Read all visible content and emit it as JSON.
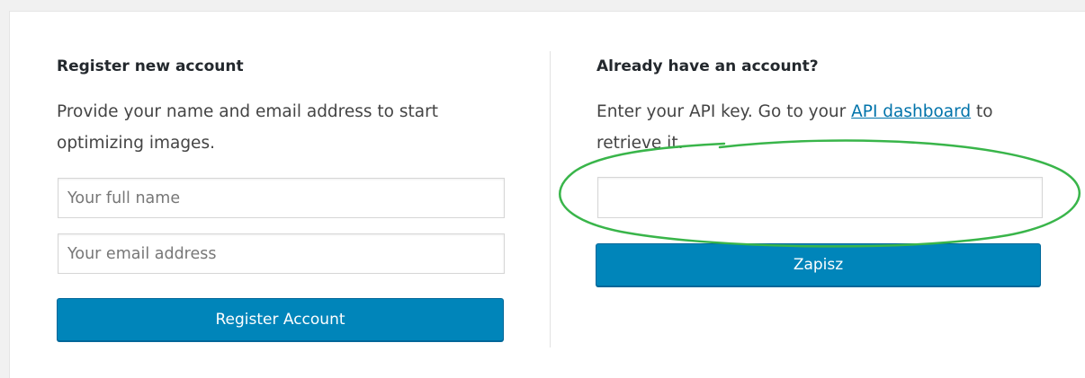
{
  "register": {
    "heading": "Register new account",
    "description": "Provide your name and email address to start optimizing images.",
    "name_placeholder": "Your full name",
    "email_placeholder": "Your email address",
    "button_label": "Register Account"
  },
  "existing": {
    "heading": "Already have an account?",
    "description_before": "Enter your API key. Go to your ",
    "link_text": "API dashboard",
    "description_after": " to retrieve it.",
    "api_key_value": "",
    "button_label": "Zapisz"
  },
  "colors": {
    "button_primary": "#0085ba",
    "link": "#0073aa",
    "annotation": "#39b54a"
  }
}
